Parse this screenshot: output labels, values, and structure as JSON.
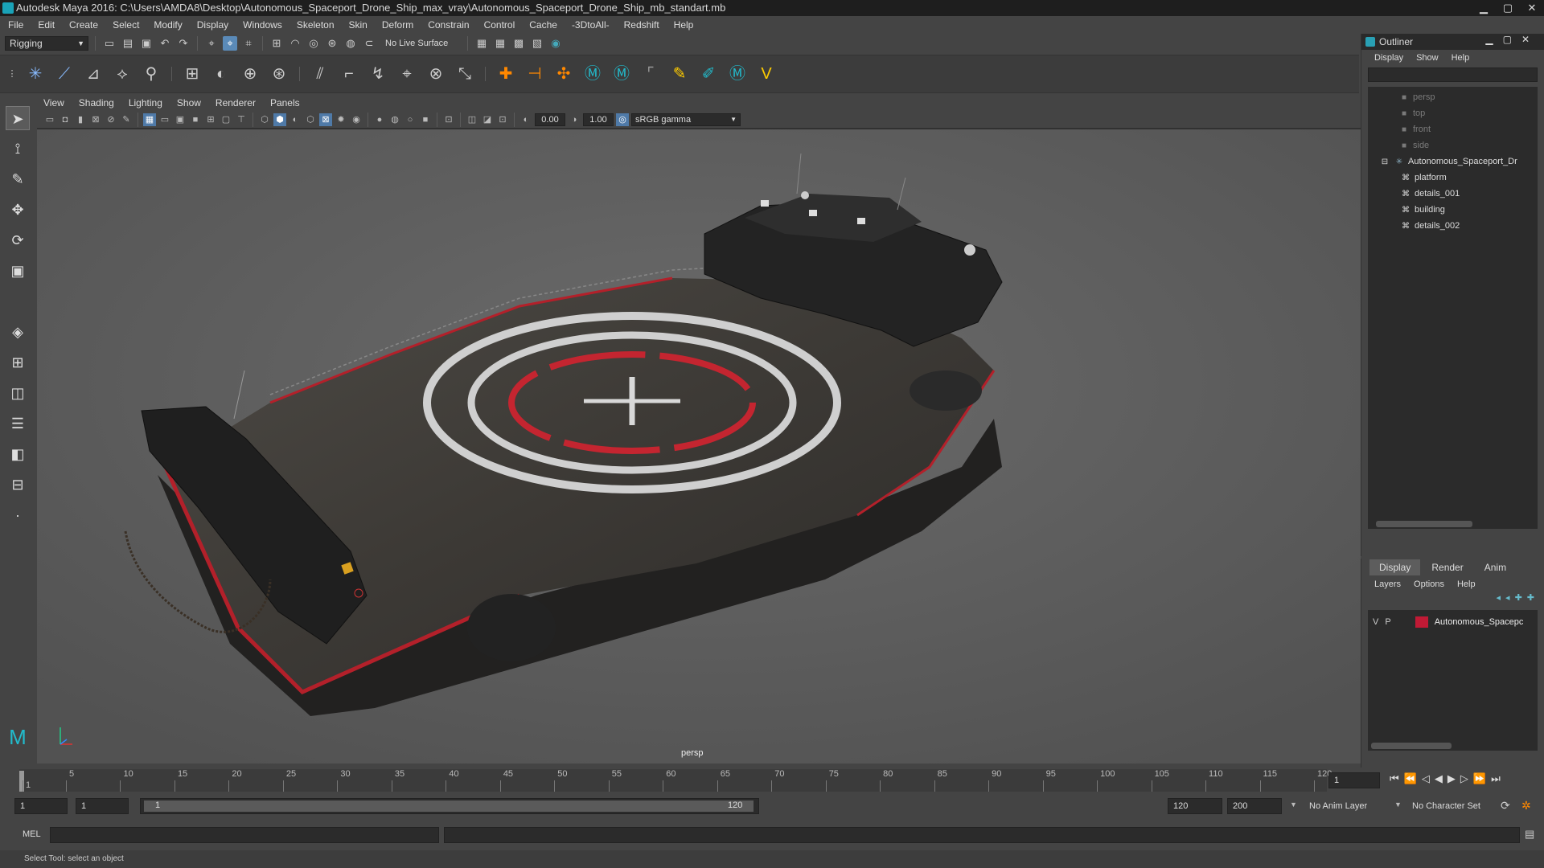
{
  "window": {
    "title": "Autodesk Maya 2016: C:\\Users\\AMDA8\\Desktop\\Autonomous_Spaceport_Drone_Ship_max_vray\\Autonomous_Spaceport_Drone_Ship_mb_standart.mb"
  },
  "menubar": [
    "File",
    "Edit",
    "Create",
    "Select",
    "Modify",
    "Display",
    "Windows",
    "Skeleton",
    "Skin",
    "Deform",
    "Constrain",
    "Control",
    "Cache",
    "-3DtoAll-",
    "Redshift",
    "Help"
  ],
  "toolbar": {
    "mode": "Rigging",
    "live_surface": "No Live Surface"
  },
  "panel": {
    "menu": [
      "View",
      "Shading",
      "Lighting",
      "Show",
      "Renderer",
      "Panels"
    ],
    "exposure": "0.00",
    "gamma": "1.00",
    "colorspace": "sRGB gamma",
    "camera": "persp"
  },
  "outliner": {
    "title": "Outliner",
    "menu": [
      "Display",
      "Show",
      "Help"
    ],
    "items": [
      {
        "label": "persp",
        "dim": true
      },
      {
        "label": "top",
        "dim": true
      },
      {
        "label": "front",
        "dim": true
      },
      {
        "label": "side",
        "dim": true
      },
      {
        "label": "Autonomous_Spaceport_Dr",
        "dim": false
      },
      {
        "label": "platform",
        "dim": false
      },
      {
        "label": "details_001",
        "dim": false
      },
      {
        "label": "building",
        "dim": false
      },
      {
        "label": "details_002",
        "dim": false
      }
    ]
  },
  "layers": {
    "tabs": [
      "Display",
      "Render",
      "Anim"
    ],
    "menu": [
      "Layers",
      "Options",
      "Help"
    ],
    "row": {
      "v": "V",
      "p": "P",
      "name": "Autonomous_Spacepc",
      "color": "#c01a35"
    }
  },
  "timeline": {
    "ticks": [
      "1",
      "5",
      "10",
      "15",
      "20",
      "25",
      "30",
      "35",
      "40",
      "45",
      "50",
      "55",
      "60",
      "65",
      "70",
      "75",
      "80",
      "85",
      "90",
      "95",
      "100",
      "105",
      "110",
      "115",
      "120"
    ],
    "current_frame": "1"
  },
  "range": {
    "start": "1",
    "playback_start": "1",
    "slider_start": "1",
    "slider_end": "120",
    "playback_end": "120",
    "end": "200",
    "anim_layer": "No Anim Layer",
    "char_set": "No Character Set"
  },
  "mel": {
    "label": "MEL"
  },
  "help": {
    "text": "Select Tool: select an object"
  }
}
